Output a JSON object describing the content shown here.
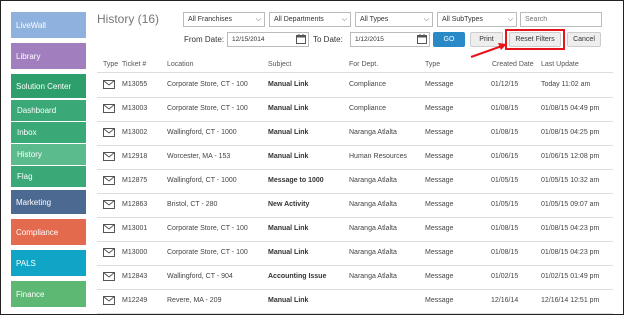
{
  "sidebar": {
    "items": [
      {
        "label": "LiveWall",
        "color": "#8fb1dd"
      },
      {
        "label": "Library",
        "color": "#a17fbf"
      },
      {
        "label": "Solution Center",
        "color": "#2e9f6c"
      },
      {
        "label": "Dashboard",
        "color": "#3aa877"
      },
      {
        "label": "Inbox",
        "color": "#3aa877"
      },
      {
        "label": "History",
        "color": "#5cbb8d"
      },
      {
        "label": "Flag",
        "color": "#3aa877"
      },
      {
        "label": "Marketing",
        "color": "#4c6a91"
      },
      {
        "label": "Compliance",
        "color": "#e46a4e"
      },
      {
        "label": "PALS",
        "color": "#10a5c6"
      },
      {
        "label": "Finance",
        "color": "#5cb873"
      }
    ]
  },
  "header": {
    "title": "History (16)",
    "filters": [
      "All Franchises",
      "All Departments",
      "All Types",
      "All SubTypes"
    ],
    "search_placeholder": "Search",
    "from_label": "From Date:",
    "from_value": "12/15/2014",
    "to_label": "To Date:",
    "to_value": "1/12/2015",
    "go": "GO",
    "print": "Print",
    "reset": "Reset Filters",
    "cancel": "Cancel"
  },
  "table": {
    "columns": [
      "Type",
      "Ticket #",
      "Location",
      "Subject",
      "For Dept.",
      "Type",
      "Created Date",
      "Last Update"
    ],
    "rows": [
      {
        "ticket": "M13055",
        "location": "Corporate Store, CT - 100",
        "subject": "Manual Link",
        "dept": "Compliance",
        "type": "Message",
        "created": "01/12/15",
        "updated": "Today 11:02 am"
      },
      {
        "ticket": "M13003",
        "location": "Corporate Store, CT - 100",
        "subject": "Manual Link",
        "dept": "Compliance",
        "type": "Message",
        "created": "01/08/15",
        "updated": "01/08/15 04:49 pm"
      },
      {
        "ticket": "M13002",
        "location": "Wallingford, CT - 1000",
        "subject": "Manual Link",
        "dept": "Naranga Atlalta",
        "type": "Message",
        "created": "01/08/15",
        "updated": "01/08/15 04:25 pm"
      },
      {
        "ticket": "M12918",
        "location": "Worcester, MA - 153",
        "subject": "Manual Link",
        "dept": "Human Resources",
        "type": "Message",
        "created": "01/06/15",
        "updated": "01/06/15 12:08 pm"
      },
      {
        "ticket": "M12875",
        "location": "Wallingford, CT - 1000",
        "subject": "Message to 1000",
        "dept": "Naranga Atlalta",
        "type": "Message",
        "created": "01/05/15",
        "updated": "01/05/15 10:32 am"
      },
      {
        "ticket": "M12863",
        "location": "Bristol, CT - 280",
        "subject": "New Activity",
        "dept": "Naranga Atlalta",
        "type": "Message",
        "created": "01/05/15",
        "updated": "01/05/15 09:07 am"
      },
      {
        "ticket": "M13001",
        "location": "Corporate Store, CT - 100",
        "subject": "Manual Link",
        "dept": "Naranga Atlalta",
        "type": "Message",
        "created": "01/08/15",
        "updated": "01/08/15 04:23 pm"
      },
      {
        "ticket": "M13000",
        "location": "Corporate Store, CT - 100",
        "subject": "Manual Link",
        "dept": "Naranga Atlalta",
        "type": "Message",
        "created": "01/08/15",
        "updated": "01/08/15 04:23 pm"
      },
      {
        "ticket": "M12843",
        "location": "Wallingford, CT - 904",
        "subject": "Accounting Issue",
        "dept": "Naranga Atlalta",
        "type": "Message",
        "created": "01/02/15",
        "updated": "01/02/15 01:49 pm"
      },
      {
        "ticket": "M12249",
        "location": "Revere, MA - 209",
        "subject": "Manual Link",
        "dept": "",
        "type": "Message",
        "created": "12/16/14",
        "updated": "12/16/14 12:51 pm"
      }
    ]
  }
}
